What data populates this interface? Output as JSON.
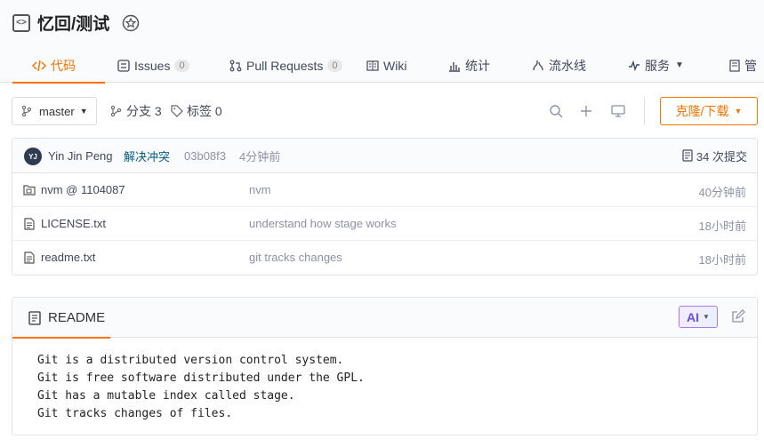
{
  "repo": {
    "name": "忆回/测试"
  },
  "tabs": [
    {
      "label": "代码",
      "active": true
    },
    {
      "label": "Issues",
      "count": "0"
    },
    {
      "label": "Pull Requests",
      "count": "0"
    },
    {
      "label": "Wiki"
    },
    {
      "label": "统计"
    },
    {
      "label": "流水线"
    },
    {
      "label": "服务"
    },
    {
      "label": "管"
    }
  ],
  "toolbar": {
    "branch": "master",
    "branches": "分支 3",
    "tags": "标签 0",
    "clone": "克隆/下载"
  },
  "commit": {
    "avatar": "YJ",
    "author": "Yin Jin Peng",
    "message": "解决冲突",
    "hash": "03b08f3",
    "time": "4分钟前",
    "count": "34 次提交"
  },
  "files": [
    {
      "name": "nvm @ 1104087",
      "type": "submodule",
      "message": "nvm",
      "time": "40分钟前"
    },
    {
      "name": "LICENSE.txt",
      "type": "file",
      "message": "understand how stage works",
      "time": "18小时前"
    },
    {
      "name": "readme.txt",
      "type": "file",
      "message": "git tracks changes",
      "time": "18小时前"
    }
  ],
  "readme": {
    "title": "README",
    "ai_label": "AI",
    "lines": [
      "Git is a distributed version control system.",
      "Git is free software distributed under the GPL.",
      "Git has a mutable index called stage.",
      "Git tracks changes of files."
    ]
  },
  "colors": {
    "accent": "#fe7300",
    "link": "#005980",
    "muted": "#8c92a4"
  }
}
